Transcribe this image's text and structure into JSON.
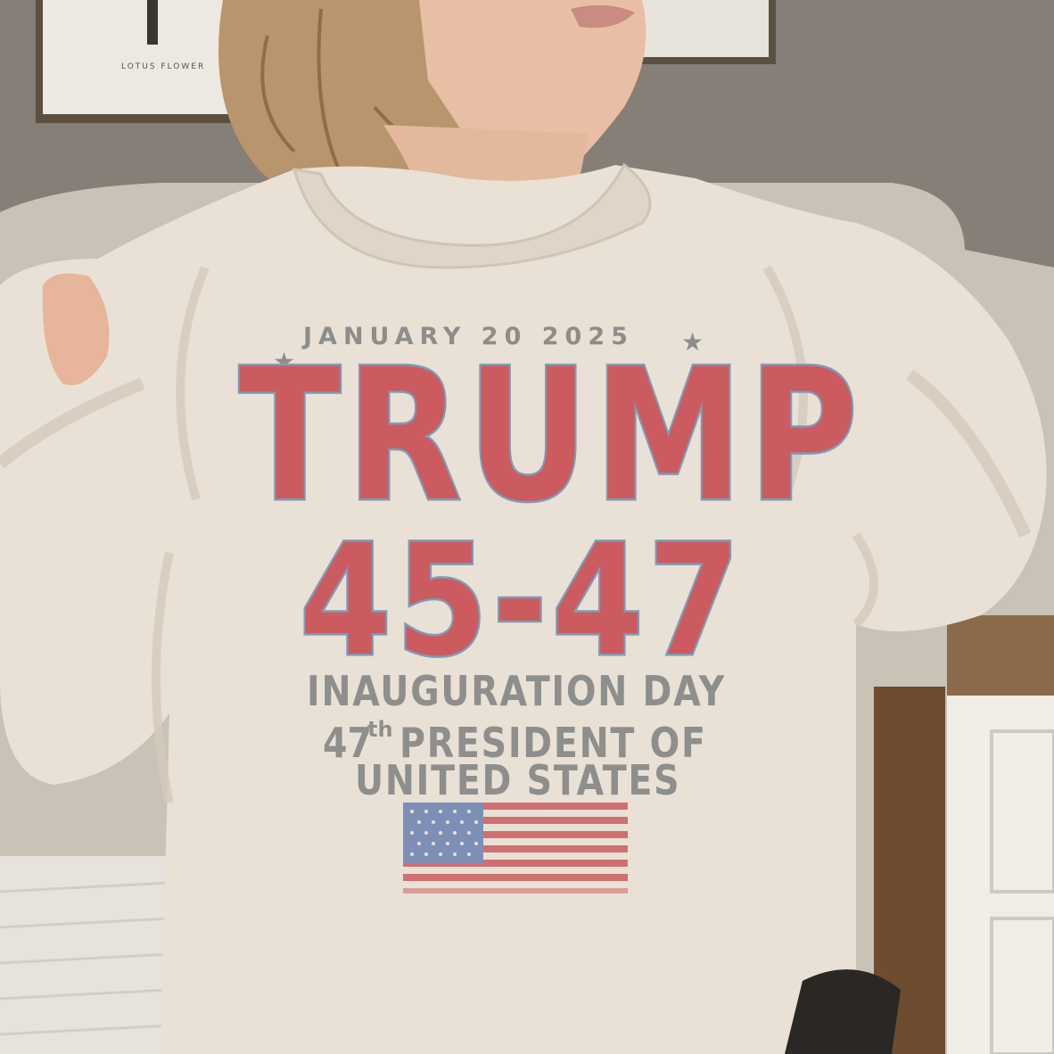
{
  "frame": {
    "caption": "LOTUS FLOWER"
  },
  "sweatshirt": {
    "date": "JANUARY 20  2025",
    "title": "TRUMP",
    "terms": "45-47",
    "line1": "INAUGURATION DAY",
    "line2_number": "47",
    "line2_suffix": "th",
    "line2_rest": "PRESIDENT OF",
    "line3": "UNITED STATES",
    "flag": "us-flag-graphic"
  },
  "colors": {
    "shirt": "#e8dfd3",
    "wall": "#8a857d",
    "print_red": "#cc5b5f",
    "print_blue_outline": "#7f9bb5",
    "print_gray": "#8e8e8c"
  }
}
